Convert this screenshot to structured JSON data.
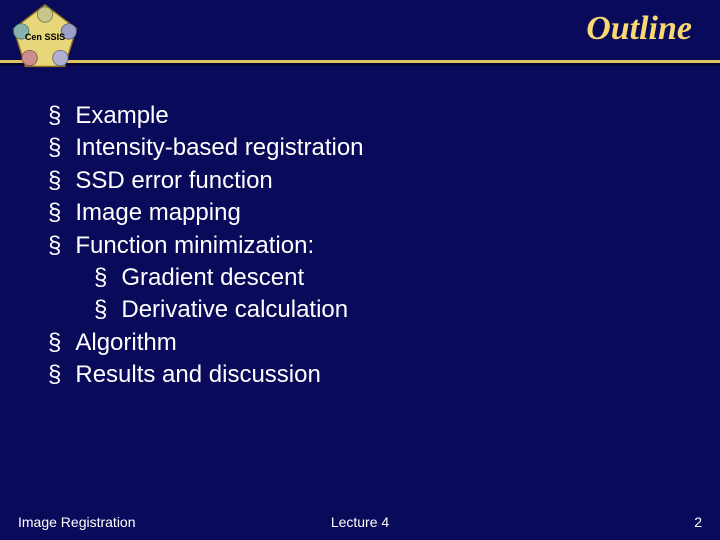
{
  "title": "Outline",
  "logo_text": "Cen SSIS",
  "bullets": {
    "b0": "Example",
    "b1": "Intensity-based registration",
    "b2": "SSD error function",
    "b3": "Image mapping",
    "b4": "Function minimization:",
    "b4_sub0": "Gradient descent",
    "b4_sub1": "Derivative calculation",
    "b5": "Algorithm",
    "b6": "Results and discussion"
  },
  "footer": {
    "left": "Image Registration",
    "center": "Lecture 4",
    "right": "2"
  }
}
